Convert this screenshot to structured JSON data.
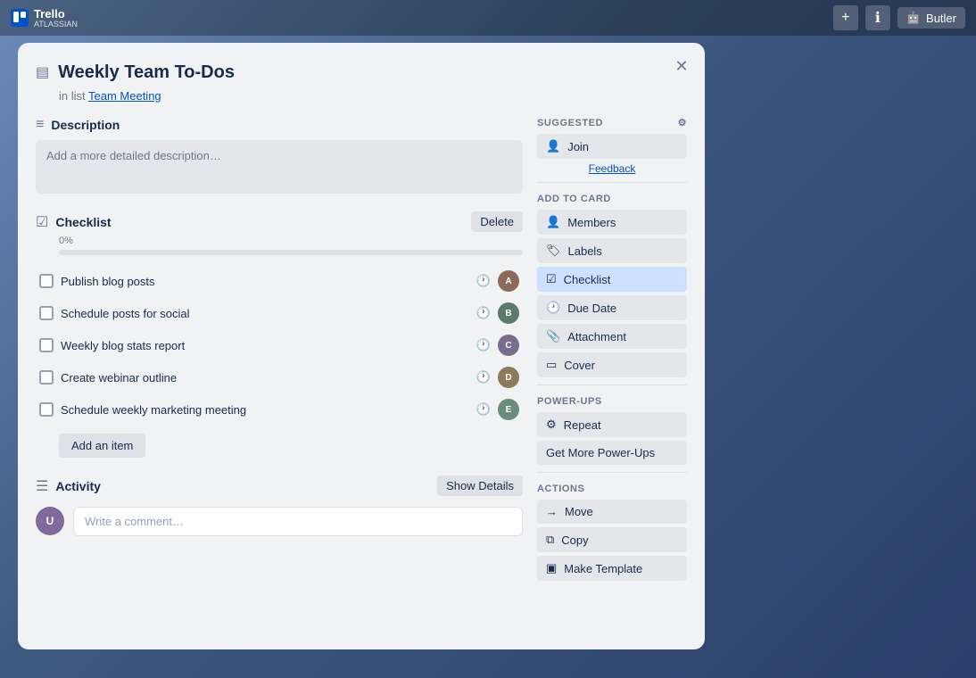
{
  "topbar": {
    "logo_text": "Trello",
    "logo_sub": "ATLASSIAN",
    "add_icon": "+",
    "info_icon": "ℹ",
    "butler_label": "Butler"
  },
  "card": {
    "title": "Weekly Team To-Dos",
    "subtitle_prefix": "in list ",
    "list_name": "Team Meeting",
    "close_icon": "✕",
    "card_icon": "▤"
  },
  "description": {
    "section_title": "Description",
    "section_icon": "≡",
    "placeholder": "Add a more detailed description…"
  },
  "checklist": {
    "section_title": "Checklist",
    "section_icon": "☑",
    "delete_label": "Delete",
    "progress_percent": "0%",
    "items": [
      {
        "text": "Publish blog posts",
        "id": "item-1"
      },
      {
        "text": "Schedule posts for social",
        "id": "item-2"
      },
      {
        "text": "Weekly blog stats report",
        "id": "item-3"
      },
      {
        "text": "Create webinar outline",
        "id": "item-4"
      },
      {
        "text": "Schedule weekly marketing meeting",
        "id": "item-5"
      }
    ],
    "add_item_label": "Add an item"
  },
  "activity": {
    "section_title": "Activity",
    "section_icon": "☰",
    "show_details_label": "Show Details",
    "comment_placeholder": "Write a comment…"
  },
  "sidebar": {
    "suggested_label": "SUGGESTED",
    "join_label": "Join",
    "join_icon": "👤",
    "feedback_label": "Feedback",
    "add_to_card_label": "ADD TO CARD",
    "members_label": "Members",
    "members_icon": "👤",
    "labels_label": "Labels",
    "labels_icon": "🏷",
    "checklist_label": "Checklist",
    "checklist_icon": "☑",
    "due_date_label": "Due Date",
    "due_date_icon": "🕐",
    "attachment_label": "Attachment",
    "attachment_icon": "📎",
    "cover_label": "Cover",
    "cover_icon": "▭",
    "power_ups_label": "POWER-UPS",
    "repeat_label": "Repeat",
    "repeat_icon": "⚙",
    "get_more_label": "Get More Power-Ups",
    "actions_label": "ACTIONS",
    "move_label": "Move",
    "move_icon": "→",
    "copy_label": "Copy",
    "copy_icon": "⧉",
    "make_template_label": "Make Template",
    "make_template_icon": "▣"
  }
}
